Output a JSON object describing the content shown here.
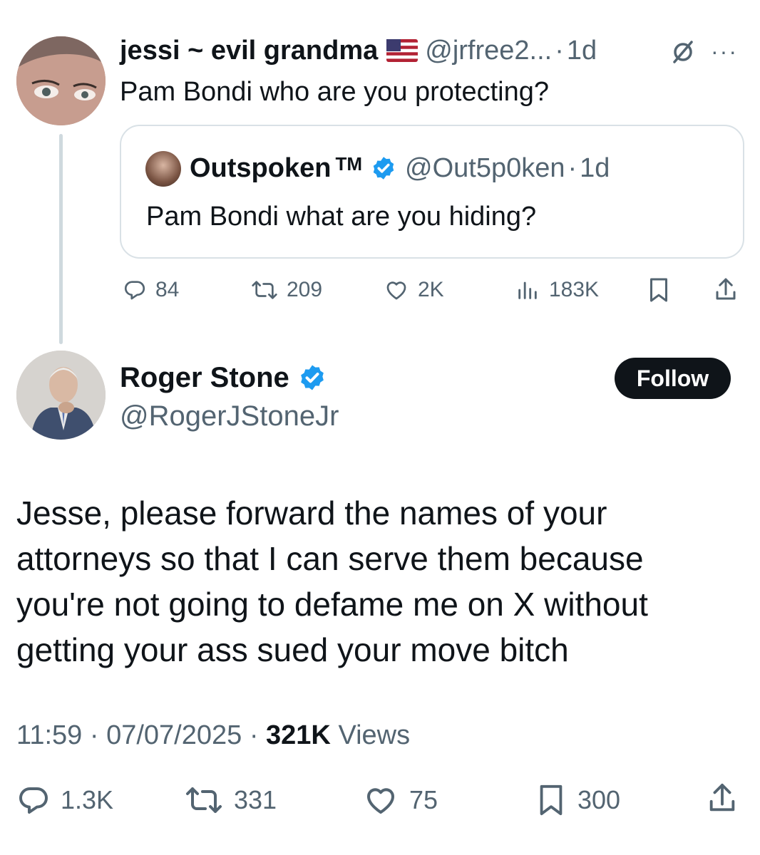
{
  "reply_tweet": {
    "author_name": "jessi ~ evil grandma",
    "flag_icon": "us-flag-icon",
    "handle": "@jrfree2...",
    "time": "1d",
    "text": "Pam Bondi who are you protecting?",
    "quoted": {
      "author_name": "Outspoken",
      "trademark": "TM",
      "handle": "@Out5p0ken",
      "time": "1d",
      "text": "Pam Bondi what are you hiding?"
    },
    "actions": {
      "replies": "84",
      "reposts": "209",
      "likes": "2K",
      "views": "183K"
    }
  },
  "main_tweet": {
    "author_name": "Roger Stone",
    "handle": "@RogerJStoneJr",
    "follow_label": "Follow",
    "text_lines": [
      "Jesse, please forward the names of your",
      "attorneys so that I can serve them because",
      "you're not going to defame me on X without",
      "getting your ass sued your move bitch"
    ],
    "time": "11:59",
    "date": "07/07/2025",
    "views_count": "321K",
    "views_label": "Views",
    "actions": {
      "replies": "1.3K",
      "reposts": "331",
      "likes": "75",
      "bookmarks": "300"
    }
  },
  "colors": {
    "text": "#0f1419",
    "secondary": "#536471",
    "verified": "#1d9bf0",
    "border": "#d9e1e6"
  }
}
